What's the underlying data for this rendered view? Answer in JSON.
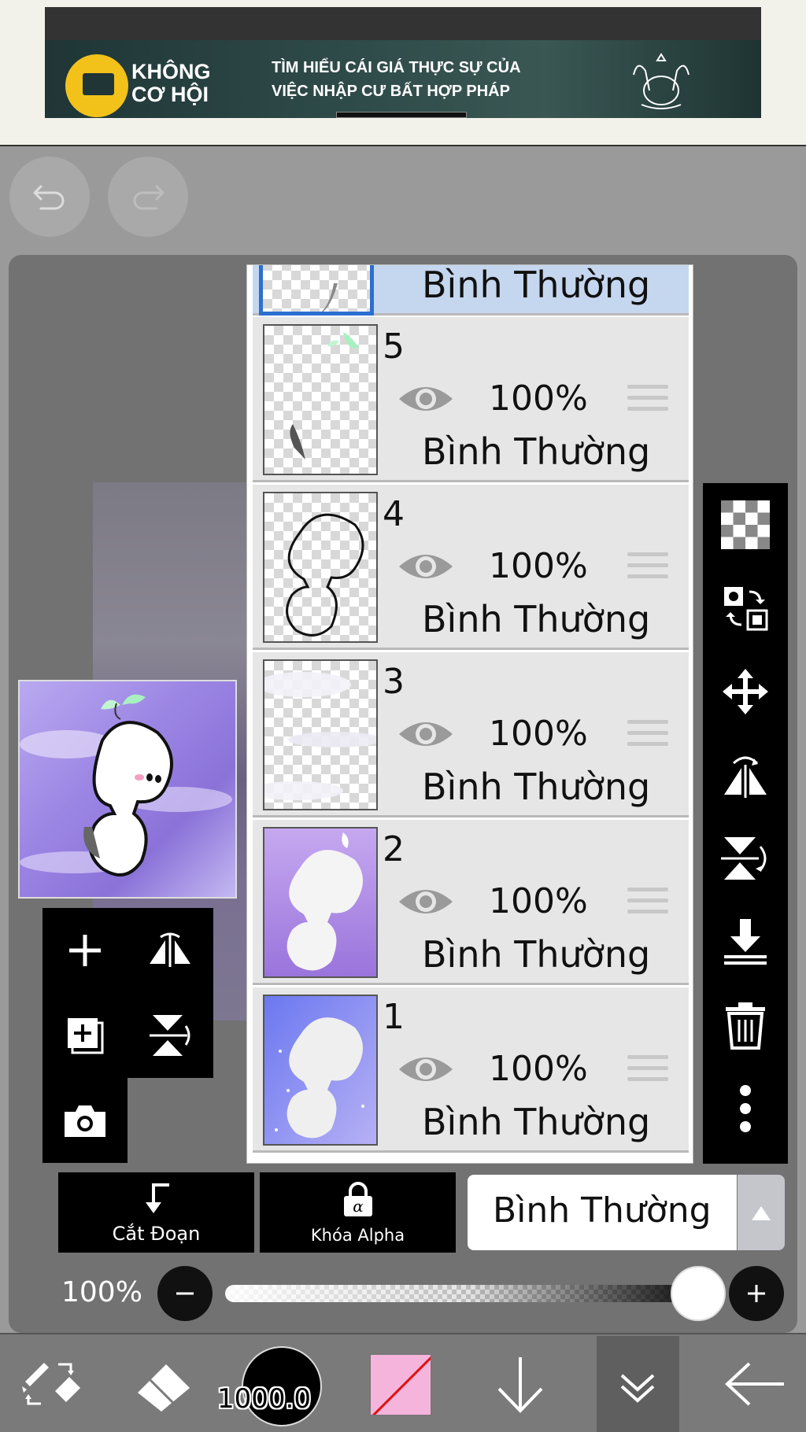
{
  "ad": {
    "brand_line1": "KHÔNG",
    "brand_line2": "CƠ HỘI",
    "text_line1": "TÌM HIỂU CÁI GIÁ THỰC SỰ CỦA",
    "text_line2": "VIỆC NHẬP CƯ BẤT HỢP PHÁP"
  },
  "layers": [
    {
      "name": "",
      "opacity": "",
      "blend": "Bình Thường",
      "selected": true,
      "partial": true
    },
    {
      "name": "5",
      "opacity": "100%",
      "blend": "Bình Thường"
    },
    {
      "name": "4",
      "opacity": "100%",
      "blend": "Bình Thường"
    },
    {
      "name": "3",
      "opacity": "100%",
      "blend": "Bình Thường"
    },
    {
      "name": "2",
      "opacity": "100%",
      "blend": "Bình Thường"
    },
    {
      "name": "1",
      "opacity": "100%",
      "blend": "Bình Thường"
    }
  ],
  "actions": {
    "clipping_label": "Cắt Đoạn",
    "alpha_lock_label": "Khóa Alpha",
    "blend_mode_value": "Bình Thường"
  },
  "opacity_slider": {
    "label": "100%",
    "value": 1.0
  },
  "bottom_bar": {
    "brush_size": "1000.0",
    "color": "#f5b4dc"
  },
  "colors": {
    "panel": "#727272",
    "selected_layer": "#c5d7ef",
    "toolbar": "#000000"
  }
}
